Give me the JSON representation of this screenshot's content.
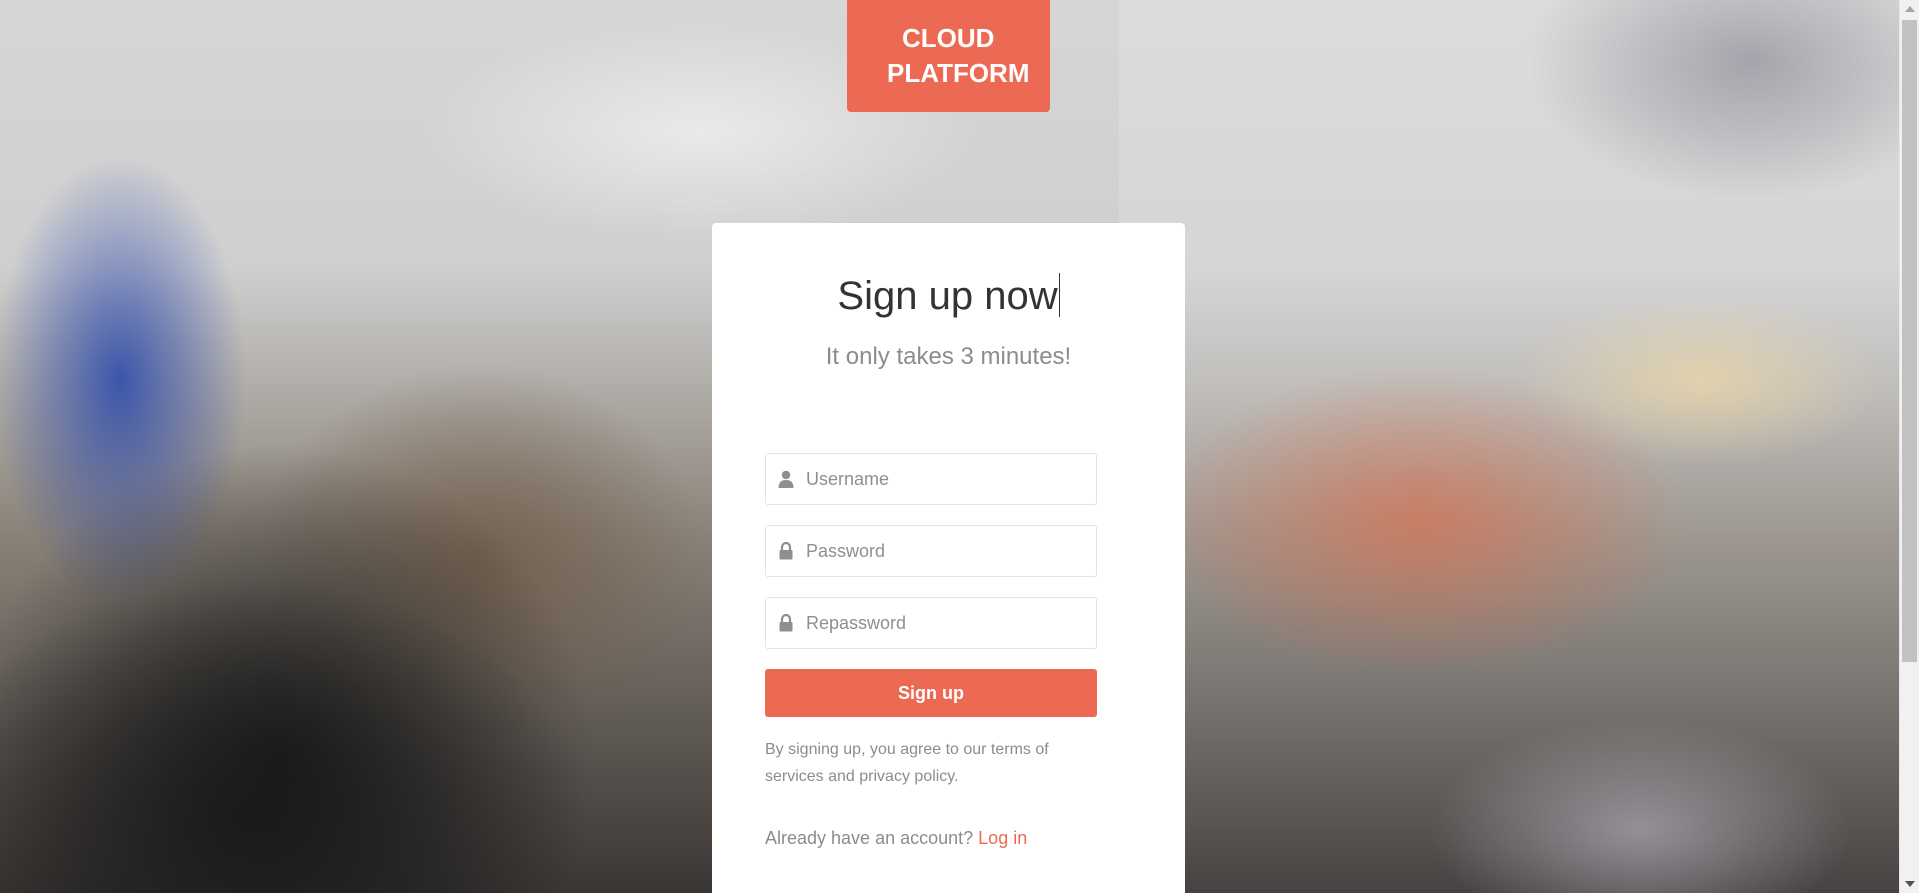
{
  "logo": {
    "line1": "CLOUD",
    "line2": "PLATFORM"
  },
  "form": {
    "title": "Sign up now",
    "subtitle": "It only takes 3 minutes!",
    "username": {
      "placeholder": "Username",
      "value": "",
      "icon": "user-icon"
    },
    "password": {
      "placeholder": "Password",
      "value": "",
      "icon": "lock-icon"
    },
    "repassword": {
      "placeholder": "Repassword",
      "value": "",
      "icon": "lock-icon"
    },
    "submit_label": "Sign up",
    "terms_text": "By signing up, you agree to our terms of services and privacy policy.",
    "login_prompt": "Already have an account?",
    "login_link": "Log in"
  },
  "colors": {
    "accent": "#ec6a53",
    "card_bg": "#ffffff",
    "title_text": "#333333",
    "muted_text": "#8c8c8c"
  }
}
